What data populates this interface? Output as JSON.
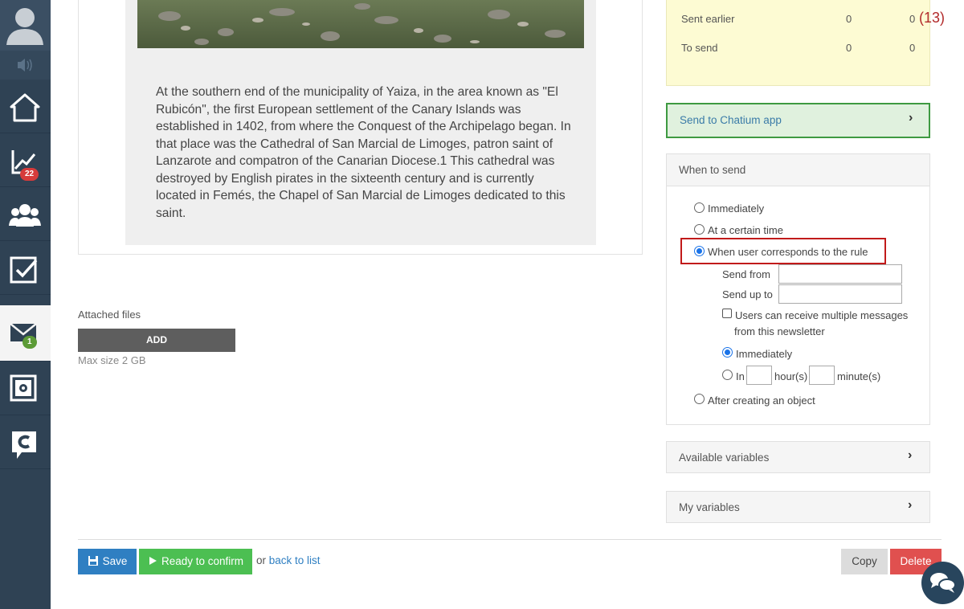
{
  "sidebar": {
    "badges": {
      "analytics": "22",
      "mail": "1"
    }
  },
  "content": {
    "article": "At the southern end of the municipality of Yaiza, in the area known as \"El Rubicón\", the first European settlement of the Canary Islands was established in 1402, from where the Conquest of the Archipelago began. In that place was the Cathedral of San Marcial de Limoges, patron saint of Lanzarote and compatron of the Canarian Diocese.1 This cathedral was destroyed by English pirates in the sixteenth century and is currently located in Femés, the Chapel of San Marcial de Limoges dedicated to this saint."
  },
  "attachments": {
    "label": "Attached files",
    "add_label": "ADD",
    "max_size": "Max size 2 GB"
  },
  "stats": {
    "rows": [
      {
        "label": "Sent earlier",
        "v1": "0",
        "v2": "0"
      },
      {
        "label": "To send",
        "v1": "0",
        "v2": "0"
      }
    ],
    "extra_count": "(13)"
  },
  "chatium": {
    "label": "Send to Chatium app"
  },
  "when_to_send": {
    "header": "When to send",
    "options": {
      "immediately": "Immediately",
      "certain_time": "At a certain time",
      "rule": "When user corresponds to the rule",
      "after_object": "After creating an object"
    },
    "send_from_label": "Send from",
    "send_from_value": "",
    "send_up_to_label": "Send up to",
    "send_up_to_value": "",
    "multi_line1": "Users can receive multiple messages",
    "multi_line2": "from this newsletter",
    "sub_immediately": "Immediately",
    "in_label": "In",
    "hours_label": "hour(s)",
    "minutes_label": "minute(s)",
    "hours_value": "",
    "minutes_value": ""
  },
  "variables": {
    "available": "Available variables",
    "mine": "My variables"
  },
  "footer": {
    "save": "Save",
    "confirm": "Ready to confirm",
    "or": "or",
    "back": "back to list",
    "copy": "Copy",
    "delete": "Delete"
  },
  "colors": {
    "sidebar": "#2f4254",
    "accent_blue": "#2f7fc2",
    "green": "#4cbf52",
    "red": "#e0504f",
    "highlight": "#c11a1a"
  }
}
